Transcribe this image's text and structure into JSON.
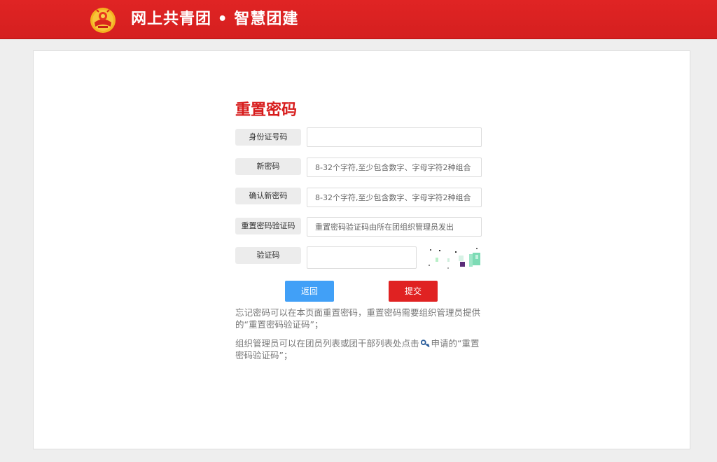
{
  "header": {
    "title": "网上共青团 • 智慧团建",
    "logo_icon": "youth-league-emblem-icon",
    "brand_color": "#d51f1f"
  },
  "form": {
    "title": "重置密码",
    "fields": [
      {
        "label": "身份证号码",
        "value": "",
        "placeholder": ""
      },
      {
        "label": "新密码",
        "value": "",
        "placeholder": "8-32个字符,至少包含数字、字母字符2种组合"
      },
      {
        "label": "确认新密码",
        "value": "",
        "placeholder": "8-32个字符,至少包含数字、字母字符2种组合"
      },
      {
        "label": "重置密码验证码",
        "value": "",
        "placeholder": "重置密码验证码由所在团组织管理员发出"
      },
      {
        "label": "验证码",
        "value": "",
        "placeholder": ""
      }
    ],
    "captcha_icon": "captcha-image"
  },
  "buttons": {
    "back_label": "返回",
    "submit_label": "提交",
    "back_color": "#41a0f7",
    "submit_color": "#e02222"
  },
  "notes": {
    "note1": "忘记密码可以在本页面重置密码，重置密码需要组织管理员提供的“重置密码验证码”；",
    "note2_before": "组织管理员可以在团员列表或团干部列表处点击",
    "note2_icon": "key-icon",
    "note2_after": "申请的“重置密码验证码”；"
  }
}
